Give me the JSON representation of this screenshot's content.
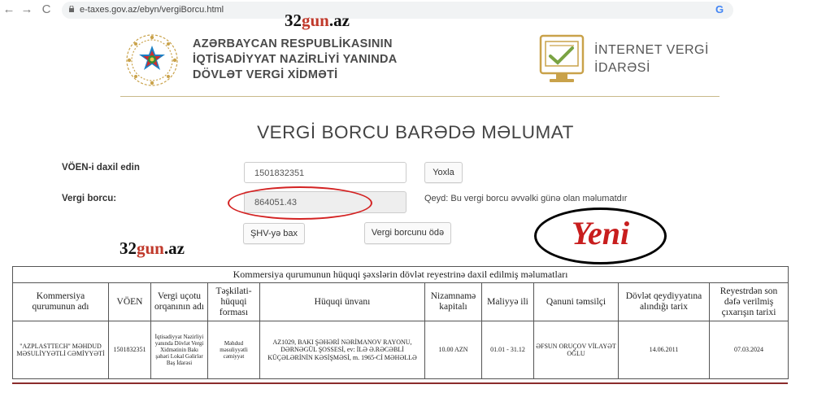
{
  "browser": {
    "back_glyph": "←",
    "forward_glyph": "→",
    "reload_glyph": "C",
    "url": "e-taxes.gov.az/ebyn/vergiBorcu.html",
    "google_glyph": "G"
  },
  "watermark": {
    "part1": "32",
    "part2": "gun",
    "part3": ".az"
  },
  "header": {
    "ministry_lines": [
      "AZƏRBAYCAN RESPUBLİKASININ",
      "İQTİSADİYYAT NAZİRLİYİ YANINDA",
      "DÖVLƏT VERGİ XİDMƏTİ"
    ],
    "ivi_lines": [
      "İNTERNET VERGİ",
      "İDARƏSİ"
    ]
  },
  "page_title": "VERGİ BORCU BARƏDƏ MƏLUMAT",
  "form": {
    "voen_label": "VÖEN-i daxil edin",
    "voen_value": "1501832351",
    "check_button": "Yoxla",
    "debt_label": "Vergi borcu:",
    "debt_value": "864051.43",
    "note": "Qeyd: Bu vergi borcu əvvəlki günə olan məlumatdır",
    "shv_button": "ŞHV-yə bax",
    "pay_button": "Vergi borcunu ödə"
  },
  "annotation": {
    "text": "Yeni"
  },
  "table": {
    "caption": "Kommersiya qurumunun hüquqi şəxslərin dövlət reyestrinə daxil edilmiş məlumatları",
    "headers": [
      "Kommersiya qurumunun adı",
      "VÖEN",
      "Vergi uçotu orqanının adı",
      "Təşkilati-hüquqi forması",
      "Hüquqi ünvanı",
      "Nizamnamə kapitalı",
      "Maliyyə ili",
      "Qanuni təmsilçi",
      "Dövlət qeydiyyatına alındığı tarix",
      "Reyestrdən son dəfə verilmiş çıxarışın tarixi"
    ],
    "row": [
      "\"AZPLASTTECH\" MƏHDUD MƏSULİYYƏTLİ CƏMİYYƏTİ",
      "1501832351",
      "İqtisadiyyat Nazirliyi yanında Dövlət Vergi Xidmətinin Bakı şəhəri Lokal Gəlirlər Baş İdarəsi",
      "Məhdud məsuliyyətli cəmiyyət",
      "AZ1029, BAKI ŞƏHƏRİ NƏRİMANOV RAYONU, DƏRNƏGÜL ŞOSSESİ, ev: İLƏ Ə.RƏCƏBLİ KÜÇƏLƏRİNİN KƏSİŞMƏSİ, m. 1965-Cİ MƏHƏLLƏ",
      "10.00 AZN",
      "01.01 - 31.12",
      "ƏFSUN ORUÇOV VİLAYƏT OĞLU",
      "14.06.2011",
      "07.03.2024"
    ]
  },
  "colors": {
    "annotation_red": "#d32222",
    "brand_gold": "#c9a24a",
    "ivi_green": "#7aa343"
  }
}
